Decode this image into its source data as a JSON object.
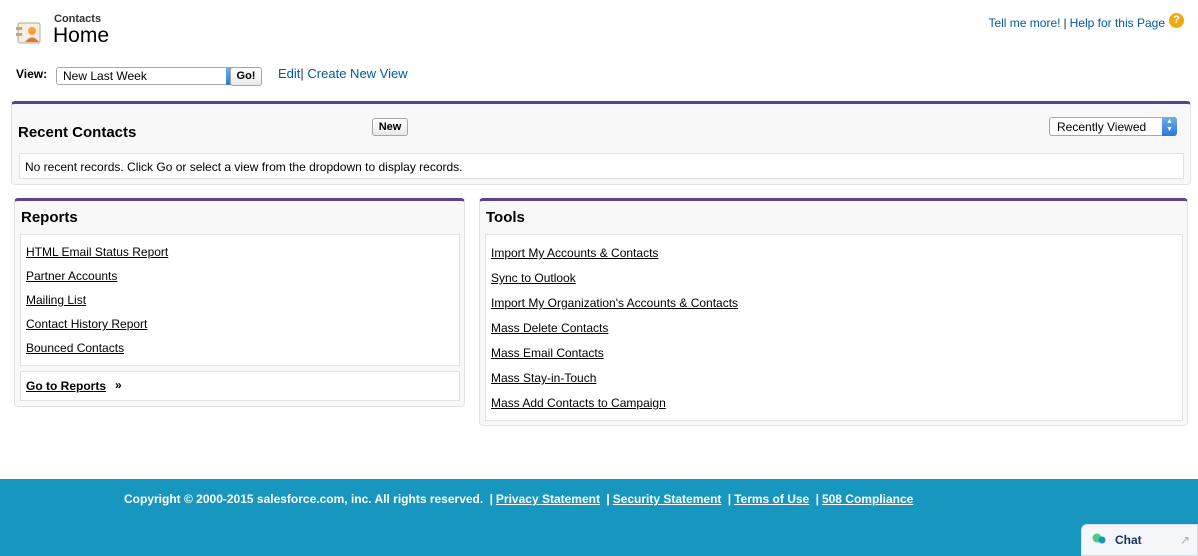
{
  "header": {
    "section": "Contacts",
    "title": "Home",
    "help_link_1": "Tell me more!",
    "help_sep": "|",
    "help_link_2": "Help for this Page",
    "help_icon": "?"
  },
  "view_bar": {
    "label": "View:",
    "selected": "New Last Week",
    "go_label": "Go!",
    "edit_label": "Edit",
    "sep": "|",
    "create_label": "Create New View"
  },
  "recent": {
    "title": "Recent Contacts",
    "new_label": "New",
    "filter_selected": "Recently Viewed",
    "message": "No recent records. Click Go or select a view from the dropdown to display records."
  },
  "reports": {
    "title": "Reports",
    "items": [
      "HTML Email Status Report",
      "Partner Accounts",
      "Mailing List",
      "Contact History Report",
      "Bounced Contacts"
    ],
    "go_to_label": "Go to Reports",
    "go_to_suffix": "»"
  },
  "tools": {
    "title": "Tools",
    "items": [
      "Import My Accounts & Contacts",
      "Sync to Outlook",
      "Import My Organization's Accounts & Contacts",
      "Mass Delete Contacts",
      "Mass Email Contacts",
      "Mass Stay-in-Touch",
      "Mass Add Contacts to Campaign"
    ]
  },
  "footer": {
    "copyright": "Copyright © 2000-2015 salesforce.com, inc. All rights reserved.",
    "sep": "|",
    "links": [
      "Privacy Statement",
      "Security Statement",
      "Terms of Use",
      "508 Compliance"
    ]
  },
  "chat": {
    "label": "Chat",
    "expand_icon": "↗"
  },
  "colors": {
    "accent_border": "#56458c",
    "link": "#015ba7",
    "footer_bg": "#1797c0"
  }
}
